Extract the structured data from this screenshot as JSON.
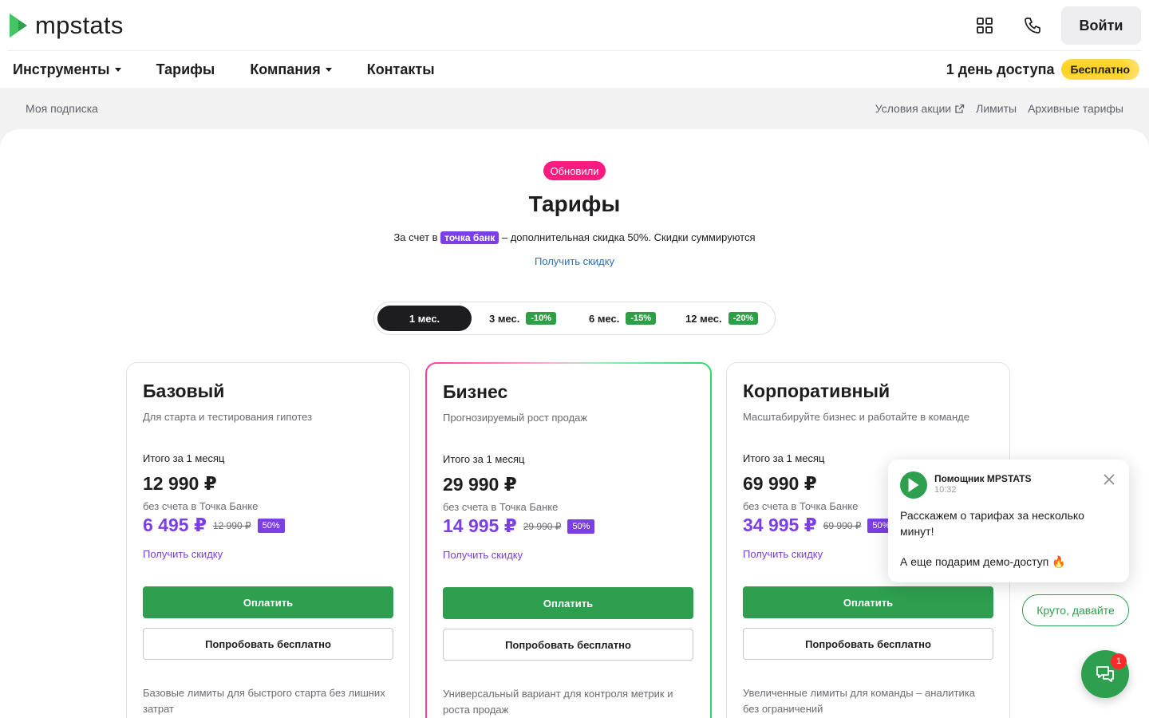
{
  "header": {
    "logo_text": "mpstats",
    "login_label": "Войти",
    "nav": [
      {
        "label": "Инструменты",
        "has_dropdown": true
      },
      {
        "label": "Тарифы",
        "has_dropdown": false
      },
      {
        "label": "Компания",
        "has_dropdown": true
      },
      {
        "label": "Контакты",
        "has_dropdown": false
      }
    ],
    "promo_text": "1 день доступа",
    "promo_badge": "Бесплатно"
  },
  "subbar": {
    "left": "Моя подписка",
    "links": [
      "Условия акции",
      "Лимиты",
      "Архивные тарифы"
    ]
  },
  "pricing": {
    "badge": "Обновили",
    "title": "Тарифы",
    "subtitle_prefix": "За счет в",
    "bank_tag": "точка банк",
    "subtitle_suffix": "– дополнительная скидка 50%. Скидки суммируются",
    "discount_link": "Получить скидку",
    "periods": [
      {
        "label": "1 мес.",
        "discount": "",
        "active": true
      },
      {
        "label": "3 мес.",
        "discount": "-10%",
        "active": false
      },
      {
        "label": "6 мес.",
        "discount": "-15%",
        "active": false
      },
      {
        "label": "12 мес.",
        "discount": "-20%",
        "active": false
      }
    ],
    "plans": [
      {
        "title": "Базовый",
        "desc": "Для старта и тестирования гипотез",
        "total_label": "Итого за 1 месяц",
        "price": "12 990 ₽",
        "note": "без счета в Точка Банке",
        "bank_price": "6 495 ₽",
        "old_price": "12 990 ₽",
        "pct": "50%",
        "get_discount": "Получить скидку",
        "pay": "Оплатить",
        "try": "Попробовать бесплатно",
        "foot": "Базовые лимиты для быстрого старта без лишних затрат"
      },
      {
        "title": "Бизнес",
        "desc": "Прогнозируемый рост продаж",
        "total_label": "Итого за 1 месяц",
        "price": "29 990 ₽",
        "note": "без счета в Точка Банке",
        "bank_price": "14 995 ₽",
        "old_price": "29 990 ₽",
        "pct": "50%",
        "get_discount": "Получить скидку",
        "pay": "Оплатить",
        "try": "Попробовать бесплатно",
        "foot": "Универсальный вариант для контроля метрик и роста продаж"
      },
      {
        "title": "Корпоративный",
        "desc": "Масштабируйте бизнес и работайте в команде",
        "total_label": "Итого за 1 месяц",
        "price": "69 990 ₽",
        "note": "без счета в Точка Банке",
        "bank_price": "34 995 ₽",
        "old_price": "69 990 ₽",
        "pct": "50%",
        "get_discount": "Получить скидку",
        "pay": "Оплатить",
        "try": "Попробовать бесплатно",
        "foot": "Увеличенные лимиты для команды – аналитика без ограничений"
      }
    ]
  },
  "chat": {
    "name": "Помощник MPSTATS",
    "time": "10:32",
    "message": "Расскажем о тарифах за несколько минут!",
    "message2": "А еще подарим демо-доступ 🔥",
    "reply": "Круто, давайте",
    "unread": "1"
  },
  "colors": {
    "brand_green": "#2e9e4f",
    "bank_purple": "#7b3fe4",
    "badge_pink": "#ff1a7f",
    "promo_yellow": "#ffd21f"
  }
}
